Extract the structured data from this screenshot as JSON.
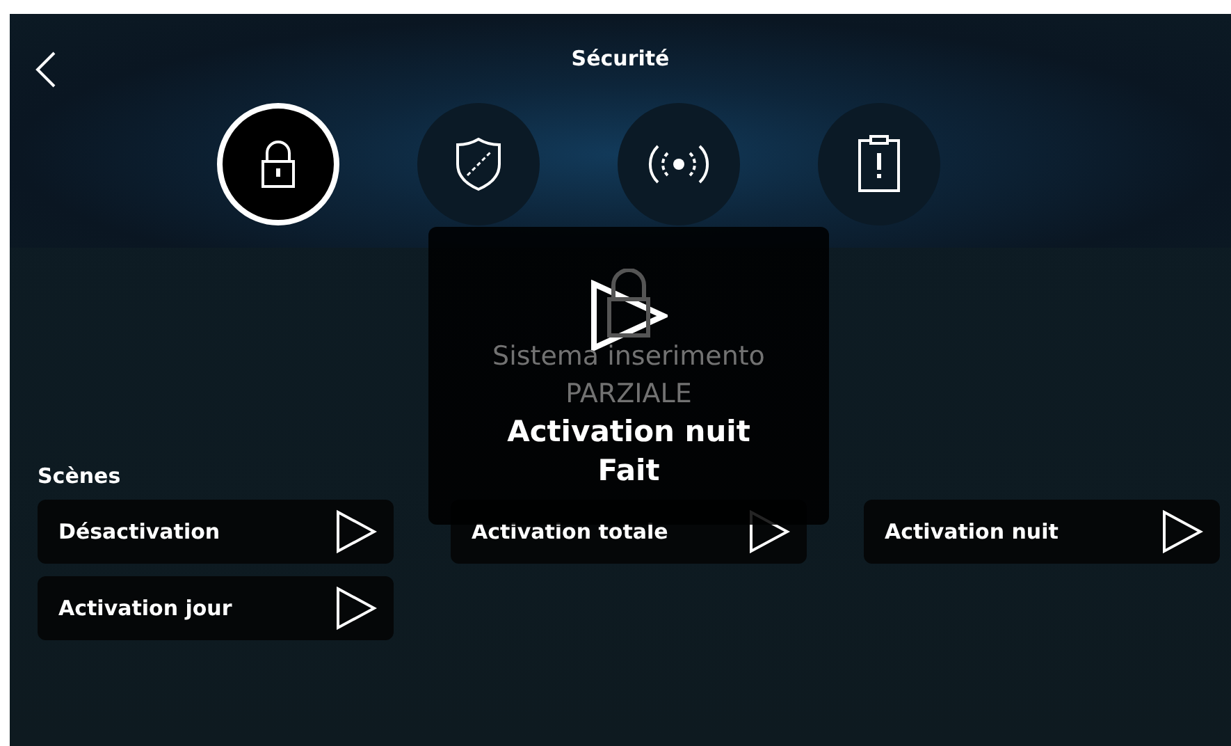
{
  "header": {
    "title": "Sécurité"
  },
  "tabs": [
    {
      "kind": "lock",
      "selected": true
    },
    {
      "kind": "shield",
      "selected": false
    },
    {
      "kind": "signal",
      "selected": false
    },
    {
      "kind": "alert",
      "selected": false
    }
  ],
  "status_card": {
    "lines": [
      "Sistema inserimento",
      "PARZIALE"
    ]
  },
  "scenes": {
    "title": "Scènes",
    "items": [
      {
        "label": "Désactivation"
      },
      {
        "label": "Activation totale"
      },
      {
        "label": "Activation nuit"
      },
      {
        "label": "Activation jour"
      }
    ]
  },
  "notification": {
    "title": "Activation nuit",
    "status": "Fait"
  }
}
